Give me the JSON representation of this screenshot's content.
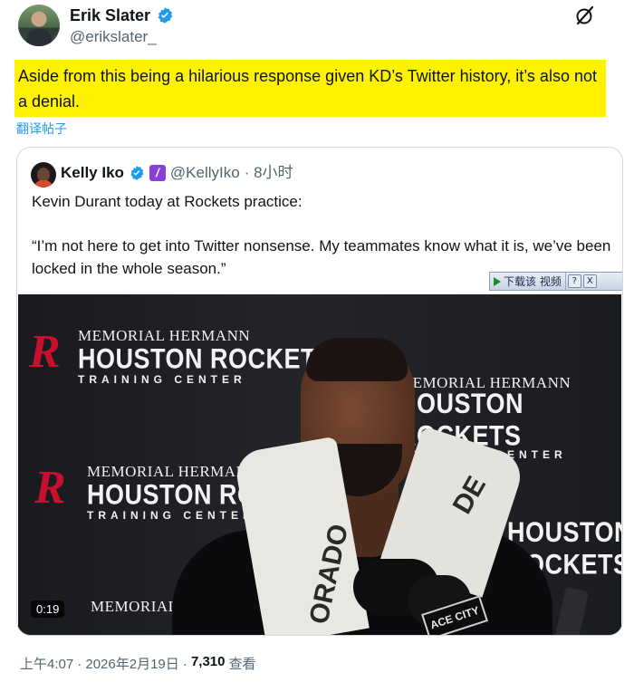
{
  "tweet": {
    "author_name": "Erik Slater",
    "author_handle": "@erikslater_",
    "text": "Aside from this being a hilarious response given KD’s Twitter history, it’s also not a denial.",
    "translate_label": "翻译帖子",
    "highlight_color": "#fff200",
    "icons": {
      "verified": "verified-badge-icon",
      "grok": "grok-icon"
    }
  },
  "quote": {
    "author_name": "Kelly Iko",
    "author_handle": "@KellyIko",
    "time": "· 8小时",
    "line1": "Kevin Durant today at Rockets practice:",
    "quote_text": "“I’m not here to get into Twitter nonsense. My teammates know what it is, we’ve been locked in the whole season.”",
    "badge_color": "#8b3fd9"
  },
  "download_bar": {
    "label": "下载该 视频",
    "help": "?",
    "close": "X"
  },
  "video": {
    "duration": "0:19",
    "backdrop": {
      "line1": "MEMORIAL HERMANN",
      "line2": "HOUSTON ROCKETS",
      "line3": "TRAINING CENTER"
    },
    "towel_text_left": "ORADO",
    "towel_text_right": "DE",
    "mic_flag": "ACE CITY"
  },
  "meta": {
    "time": "上午4:07",
    "date": "· 2026年2月19日 ·",
    "views": "7,310",
    "views_label": "查看"
  }
}
